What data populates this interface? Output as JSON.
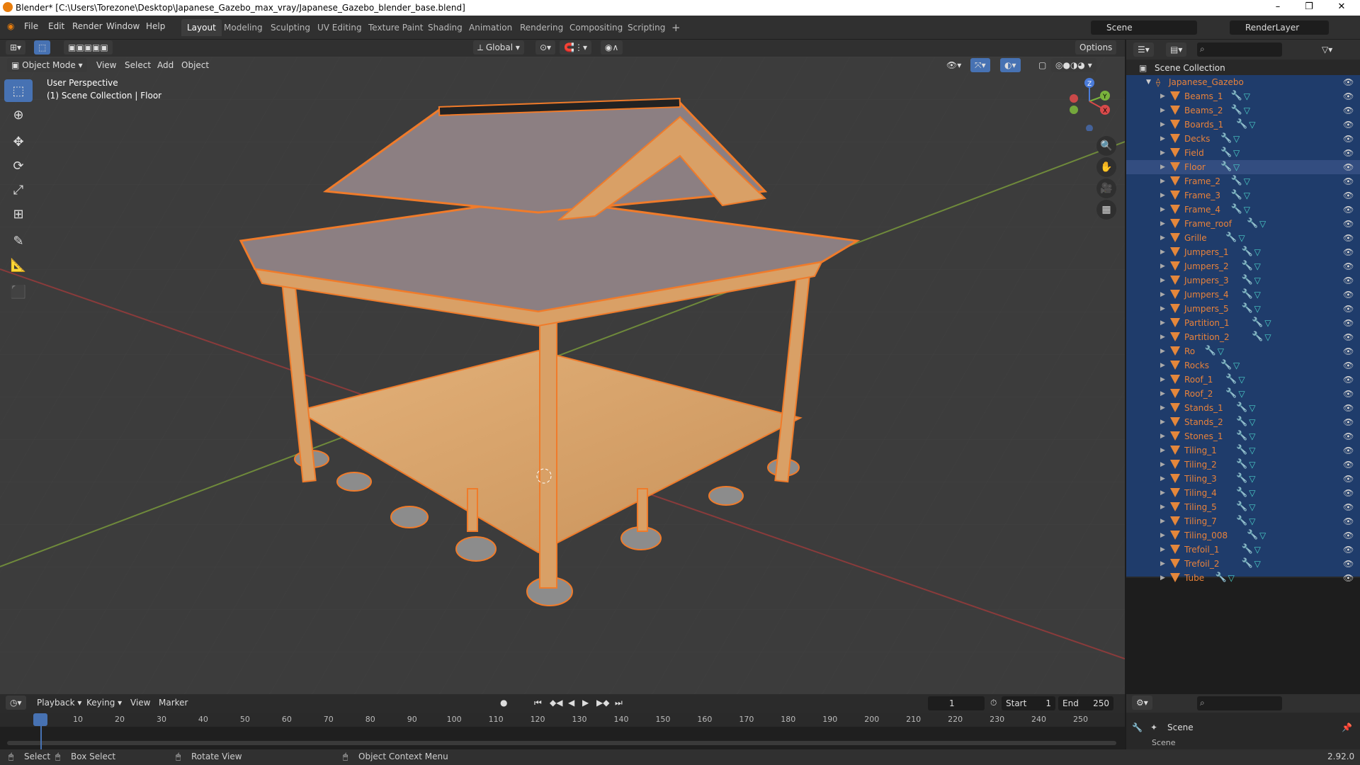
{
  "titlebar": {
    "title": "Blender* [C:\\Users\\Torezone\\Desktop\\Japanese_Gazebo_max_vray/Japanese_Gazebo_blender_base.blend]"
  },
  "menu": [
    "File",
    "Edit",
    "Render",
    "Window",
    "Help"
  ],
  "workspaces": [
    "Layout",
    "Modeling",
    "Sculpting",
    "UV Editing",
    "Texture Paint",
    "Shading",
    "Animation",
    "Rendering",
    "Compositing",
    "Scripting"
  ],
  "active_workspace": "Layout",
  "scene_field": "Scene",
  "renderlayer_field": "RenderLayer",
  "transform_orientation": "Global",
  "options_label": "Options",
  "viewport_header": {
    "mode": "Object Mode",
    "view": "View",
    "select": "Select",
    "add": "Add",
    "object": "Object"
  },
  "viewport_overlay": {
    "perspective": "User Perspective",
    "collection": "(1) Scene Collection | Floor"
  },
  "gizmo": {
    "z": "Z",
    "y": "Y",
    "x": "X"
  },
  "outliner": {
    "root": "Scene Collection",
    "collection": "Japanese_Gazebo",
    "items": [
      "Beams_1",
      "Beams_2",
      "Boards_1",
      "Decks",
      "Field",
      "Floor",
      "Frame_2",
      "Frame_3",
      "Frame_4",
      "Frame_roof",
      "Grille",
      "Jumpers_1",
      "Jumpers_2",
      "Jumpers_3",
      "Jumpers_4",
      "Jumpers_5",
      "Partition_1",
      "Partition_2",
      "Ro",
      "Rocks",
      "Roof_1",
      "Roof_2",
      "Stands_1",
      "Stands_2",
      "Stones_1",
      "Tiling_1",
      "Tiling_2",
      "Tiling_3",
      "Tiling_4",
      "Tiling_5",
      "Tiling_7",
      "Tiling_008",
      "Trefoil_1",
      "Trefoil_2",
      "Tube"
    ],
    "active_item": "Floor"
  },
  "timeline": {
    "playback": "Playback",
    "keying": "Keying",
    "view": "View",
    "marker": "Marker",
    "current_frame": "1",
    "start_label": "Start",
    "start": "1",
    "end_label": "End",
    "end": "250",
    "ticks": [
      "1",
      "10",
      "20",
      "30",
      "40",
      "50",
      "60",
      "70",
      "80",
      "90",
      "100",
      "110",
      "120",
      "130",
      "140",
      "150",
      "160",
      "170",
      "180",
      "190",
      "200",
      "210",
      "220",
      "230",
      "240",
      "250"
    ]
  },
  "properties": {
    "scene": "Scene",
    "sub": "Scene"
  },
  "statusbar": {
    "select": "Select",
    "box_select": "Box Select",
    "rotate_view": "Rotate View",
    "context_menu": "Object Context Menu",
    "version": "2.92.0"
  }
}
